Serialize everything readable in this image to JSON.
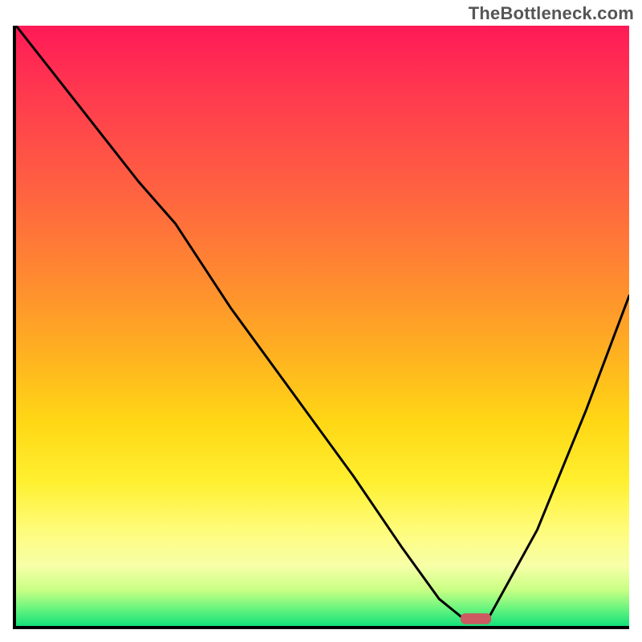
{
  "watermark": "TheBottleneck.com",
  "chart_data": {
    "type": "line",
    "title": "",
    "xlabel": "",
    "ylabel": "",
    "xlim": [
      0,
      100
    ],
    "ylim": [
      0,
      100
    ],
    "grid": false,
    "gradient_stops": [
      {
        "pos": 0,
        "color": "#ff1a57"
      },
      {
        "pos": 12,
        "color": "#ff3b4e"
      },
      {
        "pos": 28,
        "color": "#ff6340"
      },
      {
        "pos": 42,
        "color": "#ff8a30"
      },
      {
        "pos": 55,
        "color": "#ffb220"
      },
      {
        "pos": 66,
        "color": "#ffd715"
      },
      {
        "pos": 76,
        "color": "#fff030"
      },
      {
        "pos": 84,
        "color": "#fffc7a"
      },
      {
        "pos": 90,
        "color": "#f7ffa8"
      },
      {
        "pos": 94,
        "color": "#c9ff84"
      },
      {
        "pos": 97,
        "color": "#6cf57e"
      },
      {
        "pos": 100,
        "color": "#14e07a"
      }
    ],
    "series": [
      {
        "name": "bottleneck-curve",
        "x": [
          0,
          10,
          20,
          26,
          35,
          45,
          55,
          63,
          69,
          73,
          77,
          85,
          93,
          100
        ],
        "y": [
          100,
          87,
          74,
          67,
          53,
          39,
          25,
          13,
          4.5,
          1.2,
          1.2,
          16,
          36,
          55
        ]
      }
    ],
    "marker": {
      "x": 75,
      "y": 1.2,
      "width": 5,
      "height": 1.8,
      "color": "#cc5a60"
    }
  }
}
